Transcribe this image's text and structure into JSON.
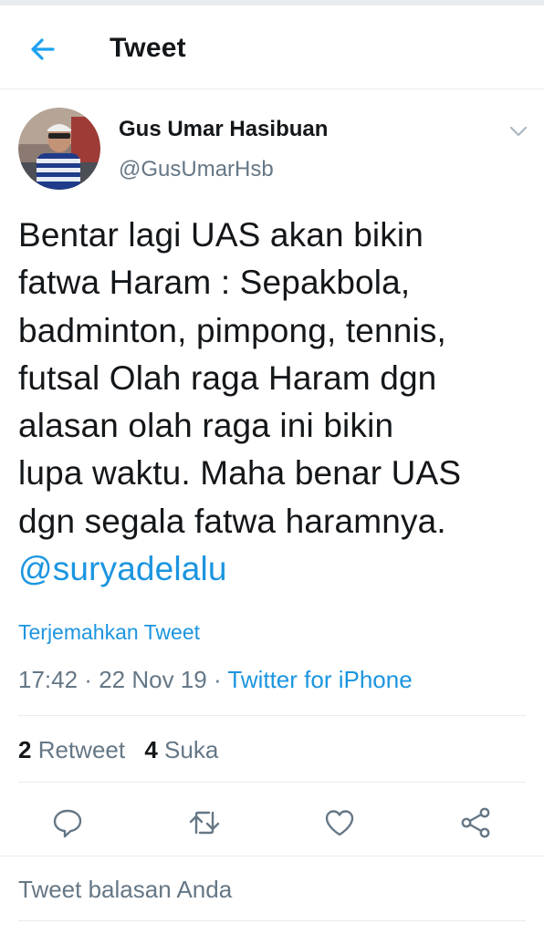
{
  "header": {
    "title": "Tweet",
    "back_icon": "arrow-left-icon"
  },
  "author": {
    "name": "Gus Umar Hasibuan",
    "handle": "@GusUmarHsb",
    "menu_icon": "chevron-down-icon"
  },
  "tweet": {
    "lines": [
      "Bentar lagi UAS akan bikin",
      "fatwa Haram : Sepakbola,",
      "badminton,  pimpong, tennis,",
      "futsal Olah raga Haram dgn",
      "alasan olah raga ini bikin",
      "lupa waktu. Maha benar UAS",
      "dgn segala fatwa haramnya."
    ],
    "mention": "@suryadelalu",
    "translate_label": "Terjemahkan Tweet",
    "time": "17:42",
    "date": "22 Nov 19",
    "separator": " · ",
    "source": "Twitter for iPhone"
  },
  "stats": {
    "retweets_count": "2",
    "retweets_label": "Retweet",
    "likes_count": "4",
    "likes_label": "Suka"
  },
  "actions": [
    "reply-icon",
    "retweet-icon",
    "like-icon",
    "share-icon"
  ],
  "reply": {
    "placeholder": "Tweet balasan Anda"
  },
  "colors": {
    "accent": "#1da1f2",
    "link": "#1b95e0",
    "text": "#14171a",
    "secondary": "#657786",
    "border": "#e6ecf0"
  }
}
